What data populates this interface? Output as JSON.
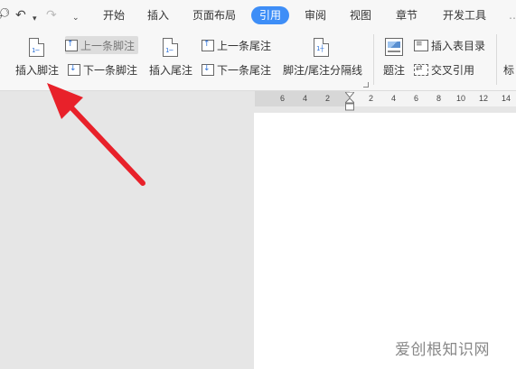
{
  "quick_access": {
    "search_icon": "search-icon",
    "undo_icon": "undo-icon",
    "redo_icon": "redo-icon",
    "more_icon": "dropdown-icon"
  },
  "menu": {
    "tabs": [
      {
        "label": "开始"
      },
      {
        "label": "插入"
      },
      {
        "label": "页面布局"
      },
      {
        "label": "引用"
      },
      {
        "label": "审阅"
      },
      {
        "label": "视图"
      },
      {
        "label": "章节"
      },
      {
        "label": "开发工具"
      }
    ],
    "active_tab": "引用",
    "accent_color": "#3e8ef7"
  },
  "ribbon": {
    "insert_footnote": "插入脚注",
    "prev_footnote": "上一条脚注",
    "next_footnote": "下一条脚注",
    "insert_endnote": "插入尾注",
    "prev_endnote": "上一条尾注",
    "next_endnote": "下一条尾注",
    "separator": "脚注/尾注分隔线",
    "caption": "题注",
    "insert_table_of_figures": "插入表目录",
    "cross_reference": "交叉引用",
    "partial_next_group": "标"
  },
  "ruler": {
    "ticks": [
      "6",
      "4",
      "2",
      "2",
      "4",
      "6",
      "8",
      "10",
      "12",
      "14"
    ]
  },
  "annotation": {
    "arrow_color": "#e8212a",
    "arrow_icon": "red-arrow-pointer"
  },
  "watermark": {
    "text": "爱创根知识网"
  }
}
